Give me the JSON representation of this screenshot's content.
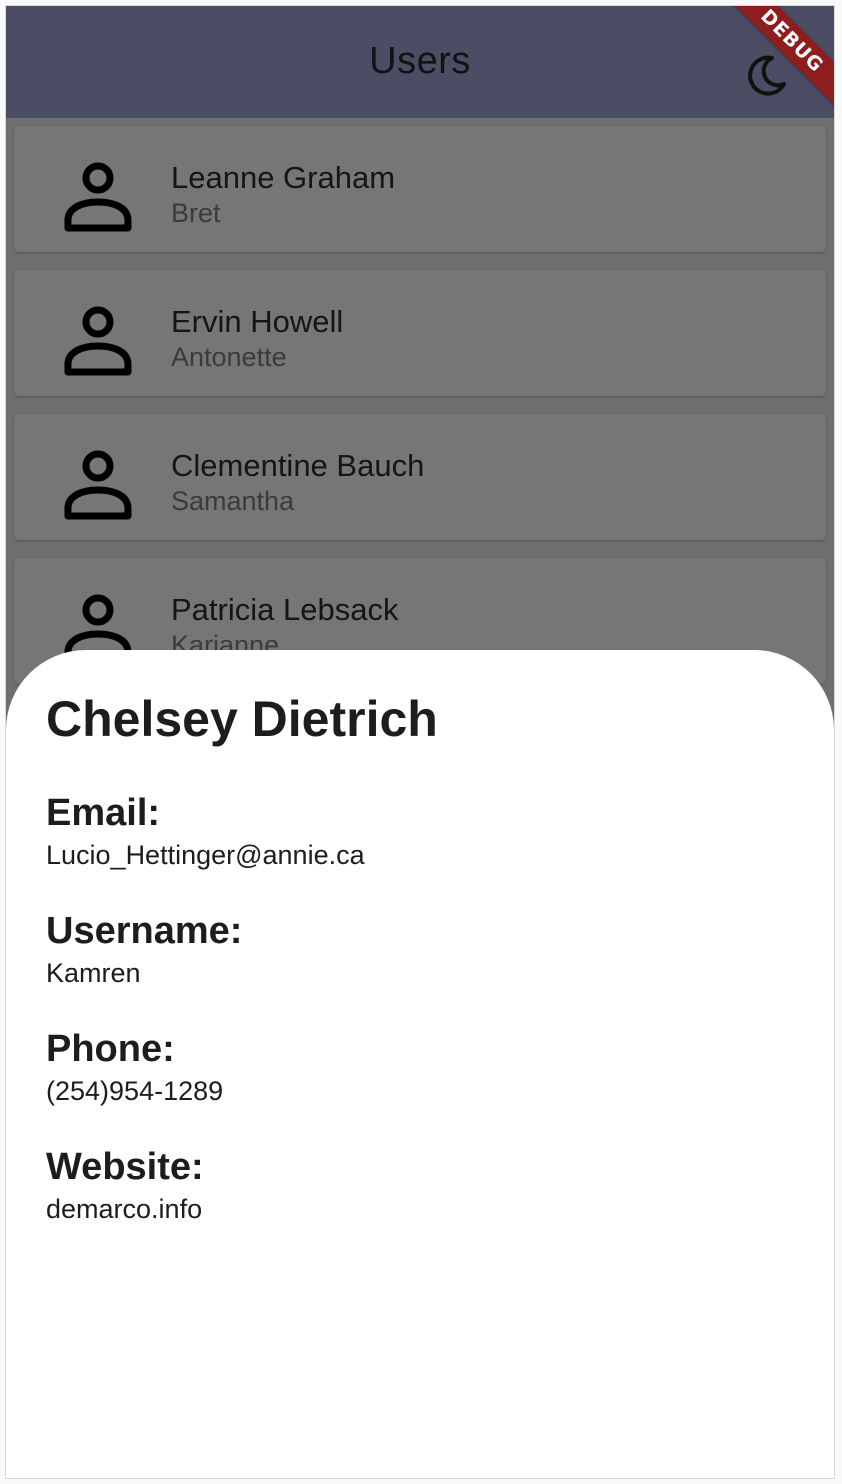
{
  "appbar": {
    "title": "Users",
    "theme_toggle_icon": "moon-icon",
    "debug_banner": "DEBUG",
    "background": "#4a4d63"
  },
  "users": [
    {
      "name": "Leanne Graham",
      "username": "Bret",
      "icon": "person-icon"
    },
    {
      "name": "Ervin Howell",
      "username": "Antonette",
      "icon": "person-icon"
    },
    {
      "name": "Clementine Bauch",
      "username": "Samantha",
      "icon": "person-icon"
    },
    {
      "name": "Patricia Lebsack",
      "username": "Karianne",
      "icon": "person-icon"
    }
  ],
  "detail": {
    "name": "Chelsey Dietrich",
    "email_label": "Email:",
    "email": "Lucio_Hettinger@annie.ca",
    "username_label": "Username:",
    "username": "Kamren",
    "phone_label": "Phone:",
    "phone": "(254)954-1289",
    "website_label": "Website:",
    "website": "demarco.info"
  }
}
